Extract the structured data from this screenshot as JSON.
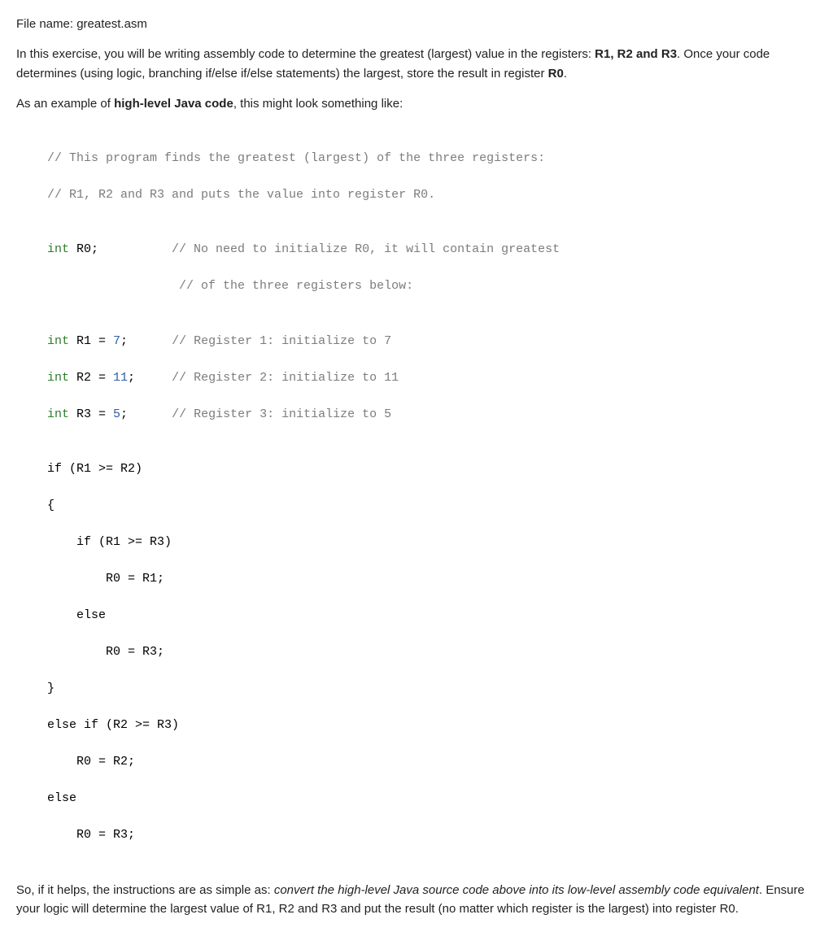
{
  "intro": {
    "filename_label": "File name:",
    "filename": "greatest.asm",
    "p1a": "In this exercise, you will be writing assembly code to determine the greatest (largest) value in the registers: ",
    "p1_regs": "R1, R2 and R3",
    "p1b": ".  Once your code determines (using logic, branching if/else if/else statements) the largest, store the result in register ",
    "p1_result_reg": "R0",
    "p1c": ".",
    "p2a": "As an example of ",
    "p2_bold": "high-level Java code",
    "p2b": ", this might look something like:"
  },
  "code": {
    "l01": "// This program finds the greatest (largest) of the three registers:",
    "l02": "// R1, R2 and R3 and puts the value into register R0.",
    "l03": "",
    "l04a": "int",
    "l04b": " R0;",
    "l04c": "          // No need to initialize R0, it will contain greatest",
    "l05": "                  // of the three registers below:",
    "l06": "",
    "l07a": "int",
    "l07b": " R1 = ",
    "l07c": "7",
    "l07d": ";",
    "l07e": "      // Register 1: initialize to 7",
    "l08a": "int",
    "l08b": " R2 = ",
    "l08c": "11",
    "l08d": ";",
    "l08e": "     // Register 2: initialize to 11",
    "l09a": "int",
    "l09b": " R3 = ",
    "l09c": "5",
    "l09d": ";",
    "l09e": "      // Register 3: initialize to 5",
    "l10": "",
    "l11a": "if",
    "l11b": " (R1 >= R2)",
    "l12": "{",
    "l13a": "    if",
    "l13b": " (R1 >= R3)",
    "l14": "        R0 = R1;",
    "l15a": "    else",
    "l16": "        R0 = R3;",
    "l17": "}",
    "l18a": "else if",
    "l18b": " (R2 >= R3)",
    "l19": "    R0 = R2;",
    "l20a": "else",
    "l21": "    R0 = R3;"
  },
  "outro": {
    "t1": "So, if it helps, the instructions are as simple as: ",
    "italic": "convert the high-level Java source code above into its low-level assembly code equivalent",
    "t2": ".  Ensure your logic will determine the largest value of R1, R2 and R3 and put the result (no matter which register is the largest) into register R0."
  }
}
